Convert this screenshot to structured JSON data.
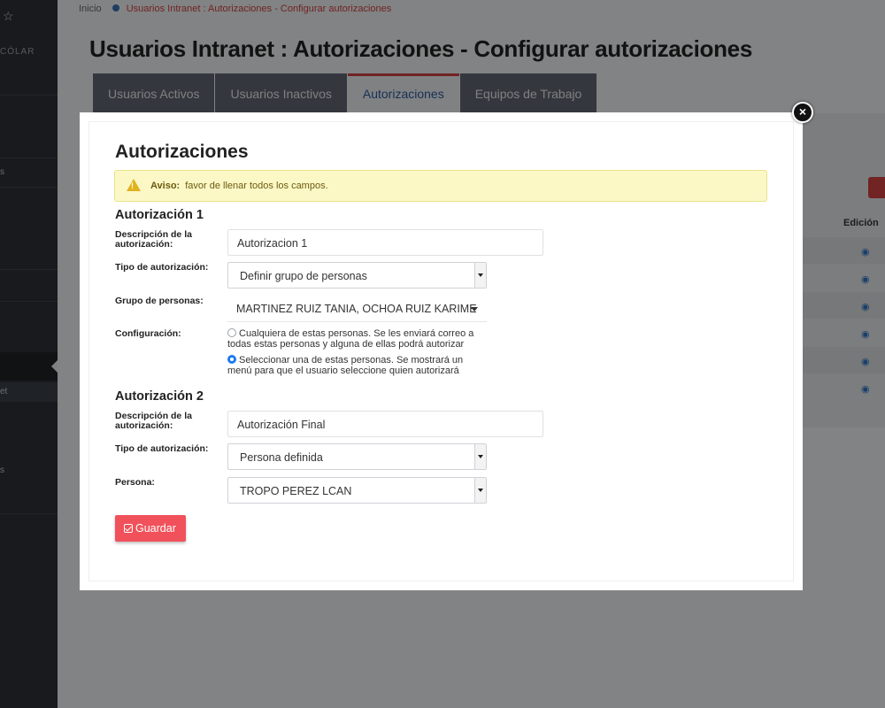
{
  "sidebar": {
    "brand": "CÓLAR",
    "items": [
      "s",
      "et",
      "s"
    ]
  },
  "breadcrumb": {
    "home": "Inicio",
    "current": "Usuarios Intranet : Autorizaciones - Configurar autorizaciones"
  },
  "page": {
    "title": "Usuarios Intranet : Autorizaciones - Configurar autorizaciones",
    "tabs": [
      "Usuarios Activos",
      "Usuarios Inactivos",
      "Autorizaciones",
      "Equipos de Trabajo"
    ],
    "active_tab": "Autorizaciones",
    "column_header": "Edición"
  },
  "modal": {
    "title": "Autorizaciones",
    "close_symbol": "×",
    "alert": {
      "label": "Aviso:",
      "message": "favor de llenar todos los campos."
    },
    "auth1": {
      "heading": "Autorización 1",
      "desc_label": "Descripción de la autorización:",
      "desc_value": "Autorizacion 1",
      "type_label": "Tipo de autorización:",
      "type_value": "Definir grupo de personas",
      "group_label": "Grupo de personas:",
      "group_value": "MARTINEZ RUIZ TANIA, OCHOA RUIZ KARIME",
      "config_label": "Configuración:",
      "option_any": "Cualquiera de estas personas. Se les enviará correo a todas estas personas y alguna de ellas podrá autorizar",
      "option_select": "Seleccionar una de estas personas. Se mostrará un menú para que el usuario seleccione quien autorizará"
    },
    "auth2": {
      "heading": "Autorización 2",
      "desc_label": "Descripción de la autorización:",
      "desc_value": "Autorización Final",
      "type_label": "Tipo de autorización:",
      "type_value": "Persona definida",
      "person_label": "Persona:",
      "person_value": "TROPO PEREZ LCAN"
    },
    "save_label": "Guardar"
  },
  "colors": {
    "accent_red": "#f0515a",
    "alert_bg": "#fbf8c6",
    "radio_blue": "#1b7bf0",
    "sidebar": "#2d3138"
  }
}
